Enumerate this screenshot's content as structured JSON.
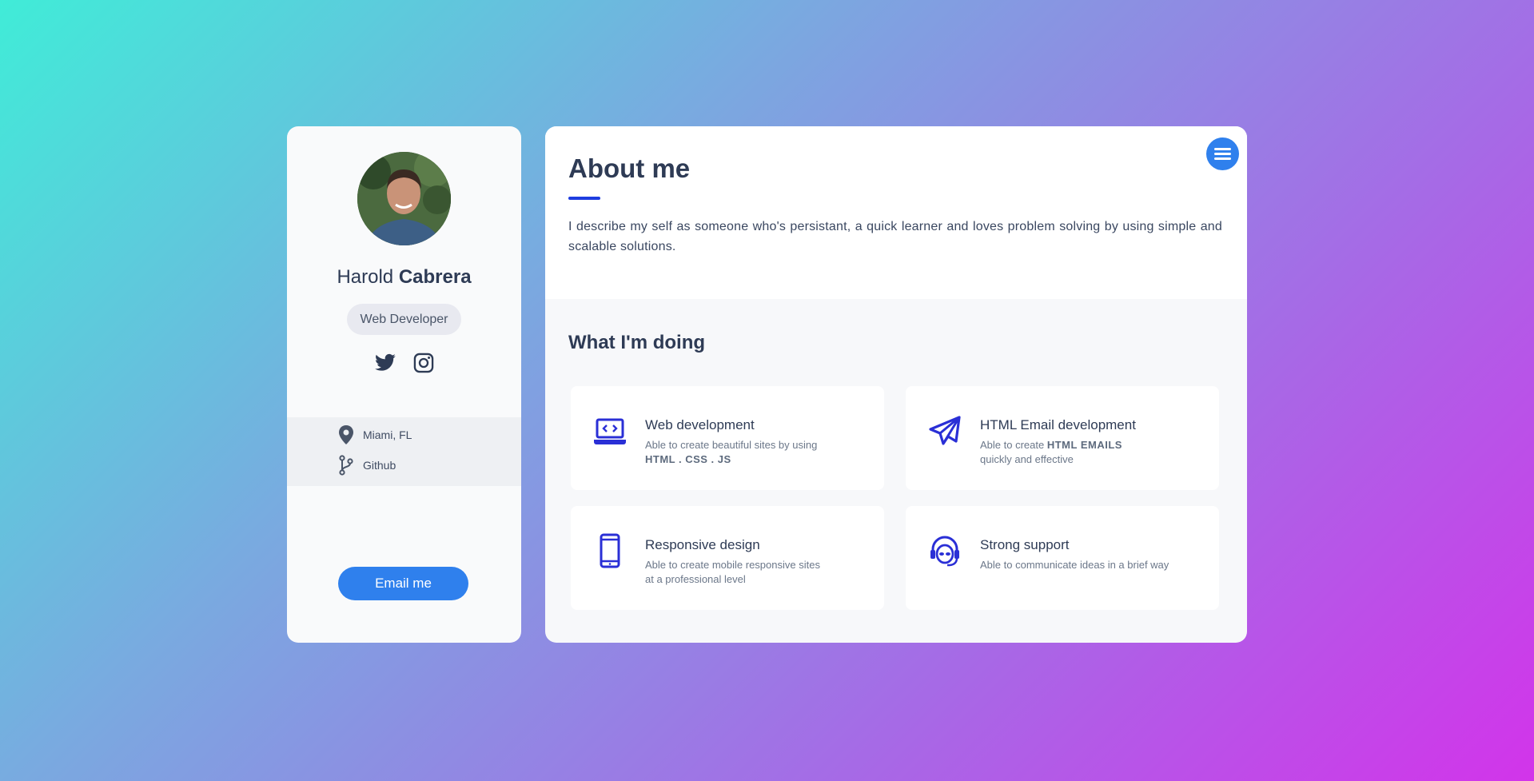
{
  "profile": {
    "first_name": "Harold",
    "last_name": "Cabrera",
    "role": "Web Developer",
    "socials": [
      "twitter-icon",
      "instagram-icon"
    ],
    "location": "Miami, FL",
    "github": "Github",
    "email_button": "Email me"
  },
  "about": {
    "title": "About me",
    "text": "I describe my self as someone who's persistant, a quick learner and loves problem solving by using simple and scalable solutions."
  },
  "doing": {
    "title": "What I'm doing",
    "services": [
      {
        "title": "Web development",
        "desc_prefix": "Able to create beautiful sites by using",
        "desc_bold": "HTML . CSS . JS",
        "desc_suffix": "",
        "icon": "laptop-code-icon"
      },
      {
        "title": "HTML Email development",
        "desc_prefix": "Able to create",
        "desc_bold": "HTML EMAILS",
        "desc_suffix": "quickly and effective",
        "icon": "paper-plane-icon"
      },
      {
        "title": "Responsive design",
        "desc_prefix": "Able to create mobile responsive sites at a professional level",
        "desc_bold": "",
        "desc_suffix": "",
        "icon": "mobile-icon"
      },
      {
        "title": "Strong support",
        "desc_prefix": "Able to communicate ideas in a brief way",
        "desc_bold": "",
        "desc_suffix": "",
        "icon": "headset-icon"
      }
    ]
  },
  "colors": {
    "accent": "#2f80ed",
    "icon_blue": "#2a2fd6",
    "text_dark": "#2e3b55"
  }
}
